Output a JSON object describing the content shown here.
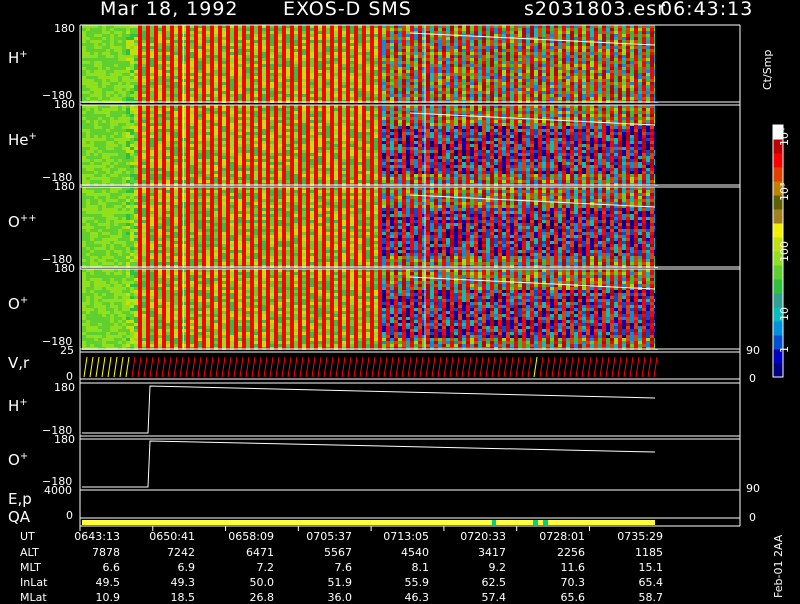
{
  "header": {
    "date": "Mar 18, 1992",
    "instrument": "EXOS-D SMS",
    "file": "s2031803.esr",
    "time": "06:43:13"
  },
  "colorbar": {
    "unit": "Ct/Smp",
    "tick_labels": [
      "1",
      "10",
      "100",
      "10³",
      "10⁴"
    ],
    "colors": [
      "#000080",
      "#0000c0",
      "#0050d0",
      "#0090e0",
      "#00c0c0",
      "#30a090",
      "#30c040",
      "#60d030",
      "#90e020",
      "#c0e010",
      "#f0f000",
      "#a08020",
      "#606000",
      "#c08000",
      "#e04000",
      "#ff0000",
      "#c00000",
      "#ffffff"
    ]
  },
  "panels": [
    {
      "name": "H+",
      "base": "H",
      "sup": "+",
      "ymax": "180",
      "ymin": "−180"
    },
    {
      "name": "He+",
      "base": "He",
      "sup": "+",
      "ymax": "180",
      "ymin": "−180"
    },
    {
      "name": "O++",
      "base": "O",
      "sup": "++",
      "ymax": "180",
      "ymin": "−180"
    },
    {
      "name": "O+",
      "base": "O",
      "sup": "+",
      "ymax": "180",
      "ymin": "−180"
    }
  ],
  "vr_panel": {
    "label": "V,r",
    "ymax": "25",
    "ymin": "0",
    "right_top": "90",
    "right_bottom": "0"
  },
  "line_panels": [
    {
      "name": "H+",
      "base": "H",
      "sup": "+",
      "ymax": "180",
      "ymin": "−180"
    },
    {
      "name": "O+",
      "base": "O",
      "sup": "+",
      "ymax": "180",
      "ymin": "−180"
    }
  ],
  "ep_panel": {
    "label": "E,p",
    "ymax": "4000",
    "right_top": "90",
    "right_bottom": "0"
  },
  "qa_panel": {
    "label": "QA",
    "ymin": "0"
  },
  "ephemeris": {
    "rows": [
      {
        "label": "UT",
        "values": [
          "0643:13",
          "0650:41",
          "0658:09",
          "0705:37",
          "0713:05",
          "0720:33",
          "0728:01",
          "0735:29"
        ]
      },
      {
        "label": "ALT",
        "values": [
          "7878",
          "7242",
          "6471",
          "5567",
          "4540",
          "3417",
          "2256",
          "1185"
        ]
      },
      {
        "label": "MLT",
        "values": [
          "6.6",
          "6.9",
          "7.2",
          "7.6",
          "8.1",
          "9.2",
          "11.6",
          "15.1"
        ]
      },
      {
        "label": "InLat",
        "values": [
          "49.5",
          "49.3",
          "50.0",
          "51.9",
          "55.9",
          "62.5",
          "70.3",
          "65.4"
        ]
      },
      {
        "label": "MLat",
        "values": [
          "10.9",
          "18.5",
          "26.8",
          "36.0",
          "46.3",
          "57.4",
          "65.6",
          "58.7"
        ]
      }
    ]
  },
  "footer_note": "Feb-01 2AA",
  "chart_data": {
    "type": "heatmap",
    "title": "Mar 18, 1992 EXOS-D SMS s2031803.esr 06:43:13",
    "x": [
      "0643:13",
      "0650:41",
      "0658:09",
      "0705:37",
      "0713:05",
      "0720:33",
      "0728:01",
      "0735:29"
    ],
    "ylim": [
      -180,
      180
    ],
    "series": [
      {
        "name": "H+",
        "type": "heatmap"
      },
      {
        "name": "He+",
        "type": "heatmap"
      },
      {
        "name": "O++",
        "type": "heatmap"
      },
      {
        "name": "O+",
        "type": "heatmap"
      },
      {
        "name": "V,r",
        "type": "line",
        "ylim": [
          0,
          25
        ]
      },
      {
        "name": "H+",
        "type": "line",
        "ylim": [
          -180,
          180
        ]
      },
      {
        "name": "O+",
        "type": "line",
        "ylim": [
          -180,
          180
        ]
      },
      {
        "name": "E,p",
        "type": "line"
      },
      {
        "name": "QA",
        "type": "bar"
      }
    ]
  }
}
